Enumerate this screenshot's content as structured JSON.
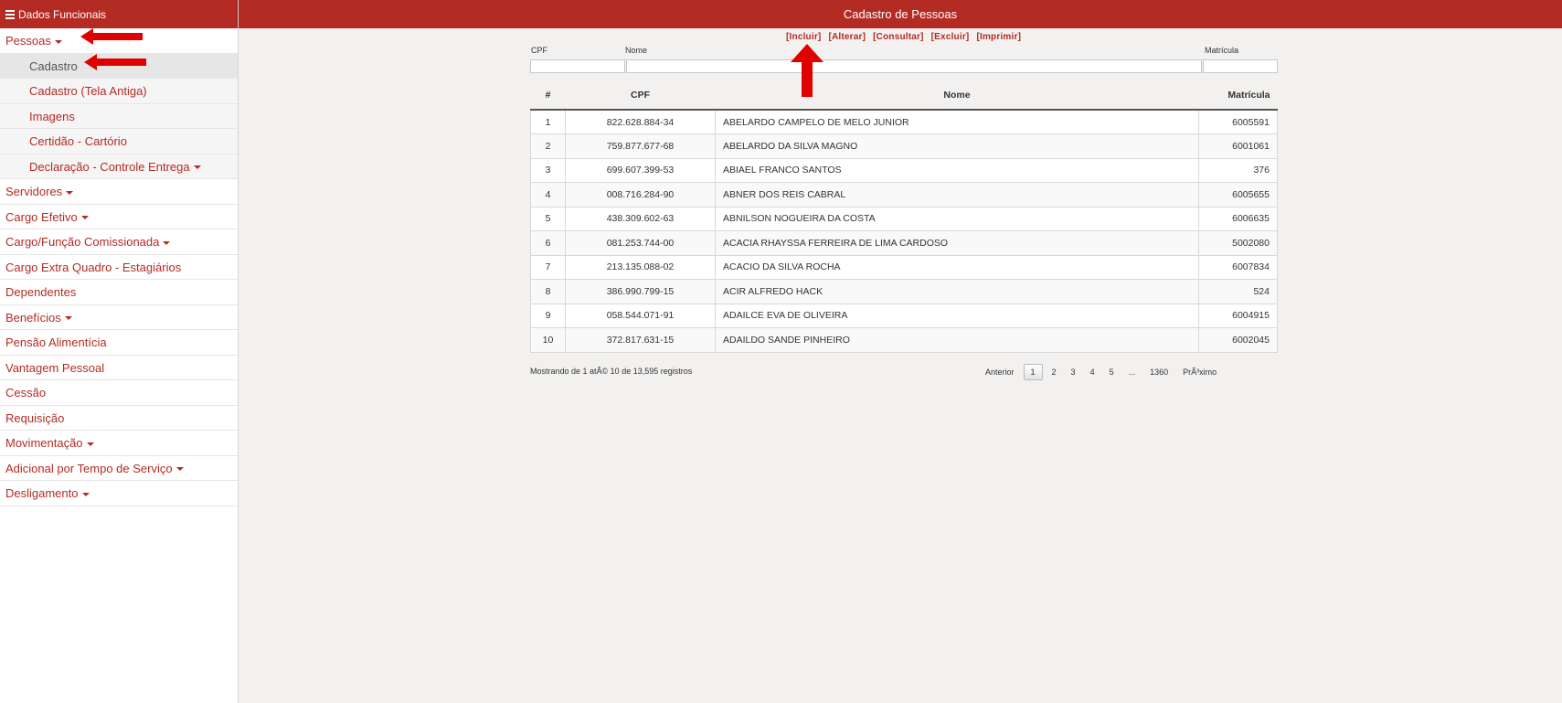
{
  "sidebar": {
    "header": "Dados Funcionais",
    "items": [
      {
        "label": "Pessoas",
        "caret": true,
        "level": 0,
        "active": false
      },
      {
        "label": "Cadastro",
        "caret": false,
        "level": 1,
        "active": true
      },
      {
        "label": "Cadastro (Tela Antiga)",
        "caret": false,
        "level": 1,
        "active": false
      },
      {
        "label": "Imagens",
        "caret": false,
        "level": 1,
        "active": false
      },
      {
        "label": "Certidão - Cartório",
        "caret": false,
        "level": 1,
        "active": false
      },
      {
        "label": "Declaração - Controle Entrega",
        "caret": true,
        "level": 1,
        "active": false
      },
      {
        "label": "Servidores",
        "caret": true,
        "level": 0,
        "active": false
      },
      {
        "label": "Cargo Efetivo",
        "caret": true,
        "level": 0,
        "active": false
      },
      {
        "label": "Cargo/Função Comissionada",
        "caret": true,
        "level": 0,
        "active": false
      },
      {
        "label": "Cargo Extra Quadro - Estagiários",
        "caret": false,
        "level": 0,
        "active": false
      },
      {
        "label": "Dependentes",
        "caret": false,
        "level": 0,
        "active": false
      },
      {
        "label": "Benefícios",
        "caret": true,
        "level": 0,
        "active": false
      },
      {
        "label": "Pensão Alimentícia",
        "caret": false,
        "level": 0,
        "active": false
      },
      {
        "label": "Vantagem Pessoal",
        "caret": false,
        "level": 0,
        "active": false
      },
      {
        "label": "Cessão",
        "caret": false,
        "level": 0,
        "active": false
      },
      {
        "label": "Requisição",
        "caret": false,
        "level": 0,
        "active": false
      },
      {
        "label": "Movimentação",
        "caret": true,
        "level": 0,
        "active": false
      },
      {
        "label": "Adicional por Tempo de Serviço",
        "caret": true,
        "level": 0,
        "active": false
      },
      {
        "label": "Desligamento",
        "caret": true,
        "level": 0,
        "active": false
      }
    ]
  },
  "main": {
    "title": "Cadastro de Pessoas",
    "actions": [
      "[Incluir]",
      "[Alterar]",
      "[Consultar]",
      "[Excluir]",
      "[Imprimir]"
    ],
    "filters": {
      "cpf_label": "CPF",
      "nome_label": "Nome",
      "matricula_label": "Matrícula"
    },
    "table": {
      "headers": [
        "#",
        "CPF",
        "Nome",
        "Matrícula"
      ],
      "rows": [
        [
          "1",
          "822.628.884-34",
          "ABELARDO CAMPELO DE MELO JUNIOR",
          "6005591"
        ],
        [
          "2",
          "759.877.677-68",
          "ABELARDO DA SILVA MAGNO",
          "6001061"
        ],
        [
          "3",
          "699.607.399-53",
          "ABIAEL FRANCO SANTOS",
          "376"
        ],
        [
          "4",
          "008.716.284-90",
          "ABNER DOS REIS CABRAL",
          "6005655"
        ],
        [
          "5",
          "438.309.602-63",
          "ABNILSON NOGUEIRA DA COSTA",
          "6006635"
        ],
        [
          "6",
          "081.253.744-00",
          "ACACIA RHAYSSA FERREIRA DE LIMA CARDOSO",
          "5002080"
        ],
        [
          "7",
          "213.135.088-02",
          "ACACIO DA SILVA ROCHA",
          "6007834"
        ],
        [
          "8",
          "386.990.799-15",
          "ACIR ALFREDO HACK",
          "524"
        ],
        [
          "9",
          "058.544.071-91",
          "ADAILCE EVA DE OLIVEIRA",
          "6004915"
        ],
        [
          "10",
          "372.817.631-15",
          "ADAILDO SANDE PINHEIRO",
          "6002045"
        ]
      ]
    },
    "info": "Mostrando de 1 atÃ© 10 de 13,595 registros",
    "pagination": {
      "prev": "Anterior",
      "pages": [
        "1",
        "2",
        "3",
        "4",
        "5",
        "...",
        "1360"
      ],
      "current": "1",
      "next": "PrÃ³ximo"
    }
  },
  "colors": {
    "brand": "#b42b24",
    "arrow": "#e00000"
  },
  "icons": {
    "menu": "hamburger-icon",
    "caret": "caret-down-icon",
    "arrow": "red-arrow-icon"
  }
}
